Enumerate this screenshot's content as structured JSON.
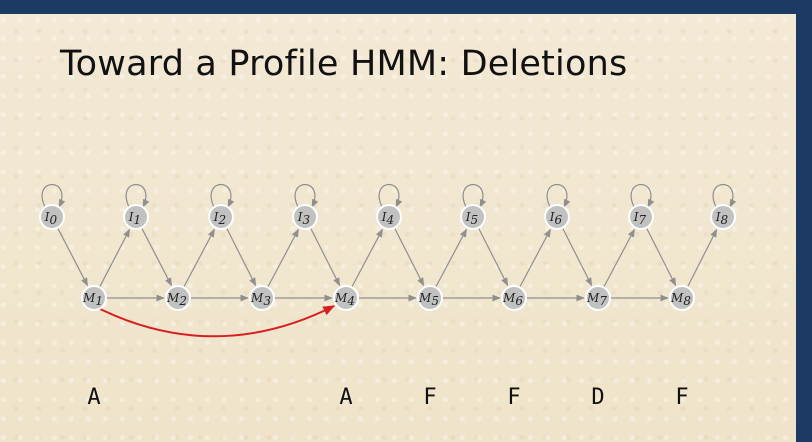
{
  "slide": {
    "title": "Toward a Profile HMM: Deletions"
  },
  "colors": {
    "background": "#1c3a63",
    "slide": "#f1e6cf",
    "node_fill": "#c1c1c1",
    "edge": "#8f8f8f",
    "deletion_edge": "#d62020"
  },
  "diagram": {
    "insertion_states": [
      {
        "base": "I",
        "sub": "0"
      },
      {
        "base": "I",
        "sub": "1"
      },
      {
        "base": "I",
        "sub": "2"
      },
      {
        "base": "I",
        "sub": "3"
      },
      {
        "base": "I",
        "sub": "4"
      },
      {
        "base": "I",
        "sub": "5"
      },
      {
        "base": "I",
        "sub": "6"
      },
      {
        "base": "I",
        "sub": "7"
      },
      {
        "base": "I",
        "sub": "8"
      }
    ],
    "match_states": [
      {
        "base": "M",
        "sub": "1"
      },
      {
        "base": "M",
        "sub": "2"
      },
      {
        "base": "M",
        "sub": "3"
      },
      {
        "base": "M",
        "sub": "4"
      },
      {
        "base": "M",
        "sub": "5"
      },
      {
        "base": "M",
        "sub": "6"
      },
      {
        "base": "M",
        "sub": "7"
      },
      {
        "base": "M",
        "sub": "8"
      }
    ],
    "deletion_transition": {
      "from": "M1",
      "to": "M4"
    },
    "emitted_symbols": [
      {
        "state": "M1",
        "symbol": "A"
      },
      {
        "state": "M4",
        "symbol": "A"
      },
      {
        "state": "M5",
        "symbol": "F"
      },
      {
        "state": "M6",
        "symbol": "F"
      },
      {
        "state": "M7",
        "symbol": "D"
      },
      {
        "state": "M8",
        "symbol": "F"
      }
    ]
  }
}
